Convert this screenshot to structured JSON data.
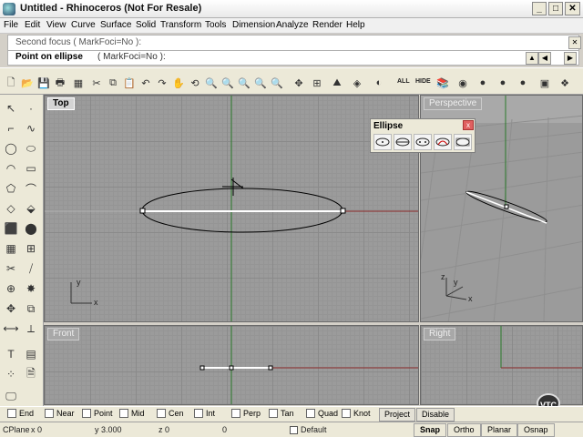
{
  "window": {
    "title": "Untitled - Rhinoceros (Not For Resale)",
    "controls": {
      "minimize": "_",
      "maximize": "□",
      "close": "✕"
    }
  },
  "menu": [
    "File",
    "Edit",
    "View",
    "Curve",
    "Surface",
    "Solid",
    "Transform",
    "Tools",
    "Dimension",
    "Analyze",
    "Render",
    "Help"
  ],
  "command": {
    "history": "Second focus ( MarkFoci=No ):",
    "prompt_label": "Point on ellipse",
    "prompt_option": "( MarkFoci=No ):"
  },
  "toolbar": {
    "all_label": "ALL",
    "hide_label": "HIDE"
  },
  "viewports": {
    "top": {
      "title": "Top",
      "axis_x": "x",
      "axis_y": "y"
    },
    "perspective": {
      "title": "Perspective",
      "axis_x": "x",
      "axis_y": "y",
      "axis_z": "z"
    },
    "front": {
      "title": "Front"
    },
    "right": {
      "title": "Right"
    }
  },
  "ellipse_palette": {
    "title": "Ellipse",
    "close": "x",
    "tools": [
      "ellipse-center-tool",
      "ellipse-diameter-tool",
      "ellipse-from-foci-tool",
      "ellipse-around-curve-tool",
      "ellipse-corner-tool"
    ]
  },
  "osnap": {
    "items": [
      {
        "label": "End",
        "checked": false
      },
      {
        "label": "Near",
        "checked": false
      },
      {
        "label": "Point",
        "checked": false
      },
      {
        "label": "Mid",
        "checked": false
      },
      {
        "label": "Cen",
        "checked": false
      },
      {
        "label": "Int",
        "checked": false
      },
      {
        "label": "Perp",
        "checked": false
      },
      {
        "label": "Tan",
        "checked": false
      },
      {
        "label": "Quad",
        "checked": false
      },
      {
        "label": "Knot",
        "checked": false
      }
    ],
    "project": "Project",
    "disable": "Disable"
  },
  "status": {
    "cplane": "CPlane",
    "x": "x 0",
    "y": "y 3.000",
    "z": "z 0",
    "z_val": "0",
    "layer": "Default",
    "snap": "Snap",
    "ortho": "Ortho",
    "planar": "Planar",
    "osnap": "Osnap"
  },
  "watermark": "VTC",
  "colors": {
    "viewport_bg": "#9b9b9b",
    "x_axis": "#8b2a2a",
    "y_axis": "#2a7a2a",
    "curve": "#000000",
    "selected_line": "#ffffff"
  }
}
